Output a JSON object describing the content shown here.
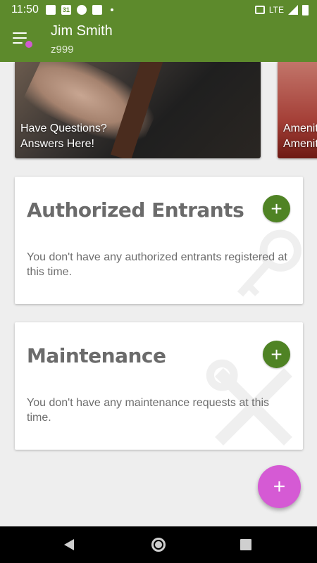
{
  "status_bar": {
    "time": "11:50",
    "network": "LTE",
    "notification_icons": [
      "image-icon",
      "calendar-icon",
      "settings-icon",
      "gmail-icon"
    ],
    "calendar_day": "31"
  },
  "header": {
    "user_name": "Jim Smith",
    "user_id": "z999",
    "menu_badge_color": "#d05ad0",
    "bar_color": "#5d8a2c"
  },
  "carousel": {
    "items": [
      {
        "caption_line1": "Have Questions?",
        "caption_line2": "Answers Here!"
      },
      {
        "caption_line1": "Amenities",
        "caption_line2": "Amenities"
      }
    ]
  },
  "sections": {
    "entrants": {
      "title": "Authorized Entrants",
      "empty_text": "You don't have any authorized entrants registered at this time.",
      "add_label": "+"
    },
    "maintenance": {
      "title": "Maintenance",
      "empty_text": "You don't have any maintenance requests at this time.",
      "add_label": "+"
    }
  },
  "fab": {
    "label": "+",
    "color": "#d55ad4"
  },
  "nav_bar": {
    "buttons": [
      "back",
      "home",
      "recents"
    ]
  }
}
